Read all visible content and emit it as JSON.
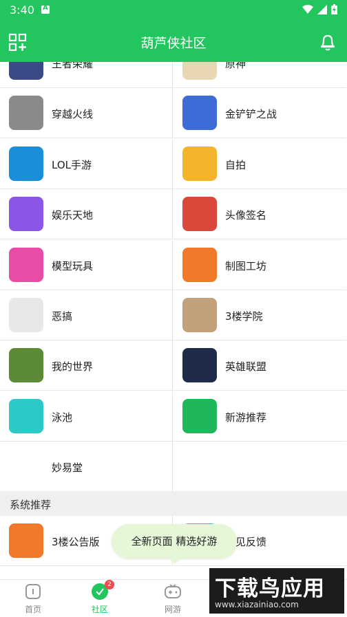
{
  "status": {
    "time": "3:40"
  },
  "header": {
    "title": "葫芦侠社区"
  },
  "games": [
    {
      "label": "王者荣耀",
      "color": "#3b4a86"
    },
    {
      "label": "原神",
      "color": "#e9d6b2"
    },
    {
      "label": "穿越火线",
      "color": "#8a8a8a"
    },
    {
      "label": "金铲铲之战",
      "color": "#3f6bd6"
    },
    {
      "label": "LOL手游",
      "color": "#1b8dd9"
    },
    {
      "label": "自拍",
      "color": "#f3b32a"
    },
    {
      "label": "娱乐天地",
      "color": "#8b55e8"
    },
    {
      "label": "头像签名",
      "color": "#d9483b"
    },
    {
      "label": "模型玩具",
      "color": "#e84ca6"
    },
    {
      "label": "制图工坊",
      "color": "#f07a2a"
    },
    {
      "label": "恶搞",
      "color": "#e8e8e8"
    },
    {
      "label": "3楼学院",
      "color": "#c2a079"
    },
    {
      "label": "我的世界",
      "color": "#5c8a35"
    },
    {
      "label": "英雄联盟",
      "color": "#1f2b4a"
    },
    {
      "label": "泳池",
      "color": "#2cc9c6"
    },
    {
      "label": "新游推荐",
      "color": "#1eb85a"
    },
    {
      "label": "妙易堂",
      "color": "#ffffff"
    }
  ],
  "section": {
    "title": "系统推荐"
  },
  "recommend": [
    {
      "label": "3楼公告版",
      "color": "#f07a2a"
    },
    {
      "label": "意见反馈",
      "color": "#2cc9c6"
    }
  ],
  "toast": {
    "text": "全新页面  精选好游"
  },
  "nav": {
    "home": "首页",
    "community": "社区",
    "community_badge": "2",
    "games": "网游"
  },
  "watermark": {
    "big": "下载鸟应用",
    "url": "www.xiazainiao.com"
  }
}
